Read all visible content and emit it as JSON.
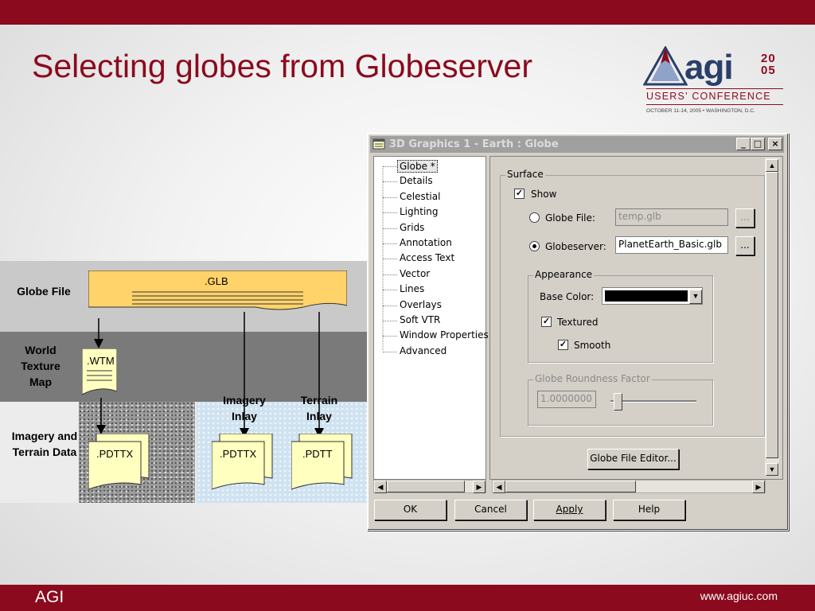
{
  "slide": {
    "title": "Selecting globes from Globeserver",
    "footer_left": "AGI",
    "footer_right": "www.agiuc.com",
    "accent_color": "#8b0a1e"
  },
  "logo": {
    "text": "agi",
    "year_top": "20",
    "year_bottom": "05",
    "conference": "USERS' CONFERENCE",
    "dates": "OCTOBER 11-14, 2005 • WASHINGTON, D.C."
  },
  "diagram": {
    "row_labels": [
      "Globe File",
      "World Texture Map",
      "Imagery and Terrain Data"
    ],
    "glb": ".GLB",
    "wtm": ".WTM",
    "col_labels": [
      "Imagery Inlay",
      "Terrain Inlay"
    ],
    "docs": [
      ".PDTTX",
      ".PDTTX",
      ".PDTT"
    ]
  },
  "window": {
    "title": "3D Graphics 1 - Earth :  Globe",
    "icon": "window-app-icon",
    "tree_items": [
      "Globe *",
      "Details",
      "Celestial",
      "Lighting",
      "Grids",
      "Annotation",
      "Access Text",
      "Vector",
      "Lines",
      "Overlays",
      "Soft VTR",
      "Window Properties",
      "Advanced"
    ],
    "surface": {
      "group_title": "Surface",
      "show_label": "Show",
      "show_checked": true,
      "globe_file_label": "Globe File:",
      "globe_file_value": "temp.glb",
      "globeserver_label": "Globeserver:",
      "globeserver_value": "PlanetEarth_Basic.glb",
      "selected_source": "Globeserver",
      "browse_label": "..."
    },
    "appearance": {
      "group_title": "Appearance",
      "base_color_label": "Base Color:",
      "base_color": "#000000",
      "textured_label": "Textured",
      "textured_checked": true,
      "smooth_label": "Smooth",
      "smooth_checked": true
    },
    "roundness": {
      "group_title": "Globe Roundness Factor",
      "value": "1.0000000"
    },
    "editor_button": "Globe File Editor...",
    "buttons": {
      "ok": "OK",
      "cancel": "Cancel",
      "apply": "Apply",
      "help": "Help"
    }
  }
}
